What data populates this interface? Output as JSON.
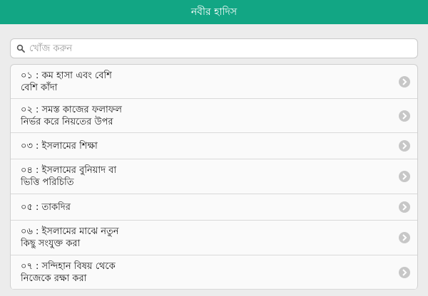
{
  "header": {
    "title": "নবীর হাদিস"
  },
  "search": {
    "placeholder": "খোঁজ করুন",
    "value": "",
    "icon": "search-icon"
  },
  "list": {
    "items": [
      {
        "label": "০১ : কম হাসা এবং বেশি\nবেশি কাঁদা"
      },
      {
        "label": "০২ : সমস্ত কাজের ফলাফল\nনির্ভর করে নিয়তের উপর"
      },
      {
        "label": "০৩ : ইসলামের শিক্ষা"
      },
      {
        "label": "০৪ : ইসলামের বুনিয়াদ বা\nভিত্তি পরিচিতি"
      },
      {
        "label": "০৫ : তাকদির"
      },
      {
        "label": "০৬ : ইসলামের মাঝে নতুন\nকিছু সংযুক্ত করা"
      },
      {
        "label": "০৭ : সন্দিহান বিষয় থেকে\nনিজেকে রক্ষা করা"
      }
    ]
  },
  "colors": {
    "header_bg": "#12a684",
    "page_bg": "#ececec",
    "chevron": "#c7c7c7"
  }
}
